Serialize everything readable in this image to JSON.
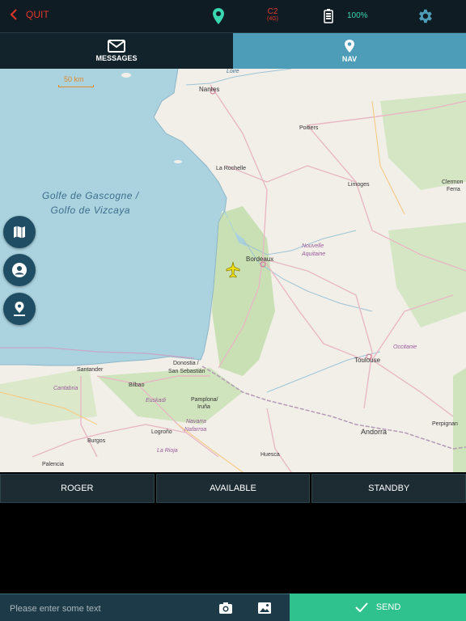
{
  "topbar": {
    "quit_label": "QUIT",
    "connection_main": "C2",
    "connection_sub": "(4G)",
    "battery_level": "100%"
  },
  "tabs": [
    {
      "label": "MESSAGES",
      "icon": "envelope-icon",
      "active": false
    },
    {
      "label": "NAV",
      "icon": "map-pin-icon",
      "active": true
    }
  ],
  "map": {
    "scale_label": "50 km",
    "sea_label_line1": "Golfe de Gascogne /",
    "sea_label_line2": "Golfo de Vizcaya",
    "places": {
      "loire": "Loire",
      "nantes": "Nantes",
      "poitiers": "Poitiers",
      "la_rochelle": "La Rochelle",
      "limoges": "Limoges",
      "clermont": "Clermon",
      "ferrand": "Ferra",
      "bordeaux": "Bordeaux",
      "nouvelle": "Nouvelle",
      "aquitaine": "Aquitaine",
      "occitanie": "Occitanie",
      "toulouse": "Toulouse",
      "santander": "Santander",
      "donostia": "Donostia /",
      "san_sebastian": "San Sebastián",
      "cantabria": "Cantabria",
      "bilbao": "Bilbao",
      "euskadi": "Euskadi",
      "pamplona": "Pamplona/",
      "irunea": "Iruña",
      "navarra": "Navarra",
      "nafarroa": "Nafarroa",
      "logrono": "Logroño",
      "la_rioja": "La Rioja",
      "burgos": "Burgos",
      "andorra": "Andorra",
      "perpignan": "Perpignan",
      "huesca": "Huesca",
      "palencia": "Palencia"
    },
    "colors": {
      "sea": "#aad3df",
      "land": "#f2efe9",
      "forest": "#c8e0b4",
      "roads": "#e8b8c4",
      "border": "#b49ab4"
    }
  },
  "quick_replies": [
    "ROGER",
    "AVAILABLE",
    "STANDBY"
  ],
  "composer": {
    "placeholder": "Please enter some text",
    "send_label": "SEND"
  },
  "colors": {
    "accent_red": "#e0392b",
    "accent_teal": "#38d7b0",
    "tab_active": "#4d9cb8",
    "send_green": "#2fc28f"
  }
}
